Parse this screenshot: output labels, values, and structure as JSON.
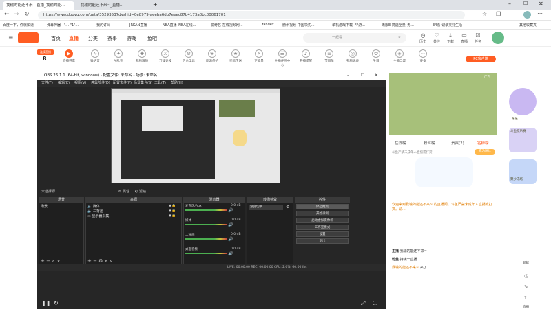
{
  "browser": {
    "tabs": [
      {
        "label": "我输的能还不来 - 直播_我输的能..."
      },
      {
        "label": "我输的能还不来~_直播..."
      }
    ],
    "url": "https://www.douyu.com/beta/35293537dyshid=0e8979-aeeba6db7eeec87b4173a0bc00061701",
    "bookmarks": [
      "百度一下，你就知道",
      "弹幕神器 - \"... \"1\"...",
      "我的订阅",
      "JRKAN直播",
      "NBA直播_NBA在线...",
      "爱奇艺-在线视频网...",
      "Yandex",
      "腾讯视频-中国领先...",
      "单机游戏下载_FF游...",
      "无限E 简选全量_无...",
      "34看-记录美好生活"
    ],
    "other_bookmarks": "其他收藏夹"
  },
  "douyu": {
    "nav": [
      "首页",
      "直播",
      "分类",
      "赛事",
      "游戏",
      "鱼吧"
    ],
    "search_placeholder": "一起看",
    "user_icons": [
      "历史",
      "关注",
      "下载",
      "直播",
      "任务"
    ]
  },
  "room": {
    "rank": "连续直播",
    "rank_num": "8",
    "tools": [
      "直播开车",
      "微语音",
      "AI礼物",
      "礼物跟随",
      "刀锋竞技",
      "后台工具",
      "能源保护",
      "星际传送",
      "正能量",
      "主播任务中心",
      "开播提醒",
      "节目单",
      "礼物记录",
      "生日",
      "主播口袋",
      "更多"
    ],
    "pc_button": "PC客户端"
  },
  "obs": {
    "title": "OBS 26.1.1 (64-bit, windows) - 配置文件: 未命名 - 场景: 未命名",
    "menu": [
      "文件(F)",
      "编辑(E)",
      "视图(V)",
      "停靠部件(D)",
      "配置文件(P)",
      "场景集合(S)",
      "工具(T)",
      "帮助(H)"
    ],
    "no_source": "未选择源",
    "props": "属性",
    "filters": "滤镜",
    "docks": {
      "scenes": "场景",
      "sources": "来源",
      "mixer": "混音器",
      "transitions": "转场特效",
      "controls": "控件"
    },
    "scene_item": "场景",
    "sources": [
      "媒体",
      "二背画",
      "显示器采集"
    ],
    "mixer": [
      {
        "name": "麦克风/Aux",
        "db": "0.0 dB"
      },
      {
        "name": "媒体",
        "db": "0.0 dB"
      },
      {
        "name": "二背画",
        "db": "0.0 dB"
      },
      {
        "name": "桌面音频",
        "db": "0.0 dB"
      }
    ],
    "transition": "渐变切换",
    "controls": [
      "停止推流",
      "开始录制",
      "启动虚拟摄像机",
      "工作室模式",
      "设置",
      "退出"
    ],
    "status": "LIVE: 00:00:00    REC: 00:00:00    CPU: 2.6%, 60.00 fps"
  },
  "right": {
    "tabs": [
      "在线榜",
      "粉丝榜",
      "贵宾(2)",
      "钻粉榜"
    ],
    "notice": "欢迎来到我输的能还不来~ 的直播间。斗鱼严禁未成年人直播或打赏。请...",
    "chat1_user": "主播",
    "chat1_text": "我输的能还不来~",
    "chat2_user": "粉丝",
    "chat2_text": "持续一直播",
    "chat3_user": "我输的能还不来~",
    "chat3_text": "来了",
    "ad": "广告",
    "banner": "斗鱼严禁未成年人直播或打赏",
    "fav_label": "成为粉丝"
  },
  "sidebar": {
    "item1": "报名",
    "item2": "斗鱼欢乐赛",
    "item3": "聚沙成塔",
    "item4": "新鲜",
    "item5": "直播"
  }
}
